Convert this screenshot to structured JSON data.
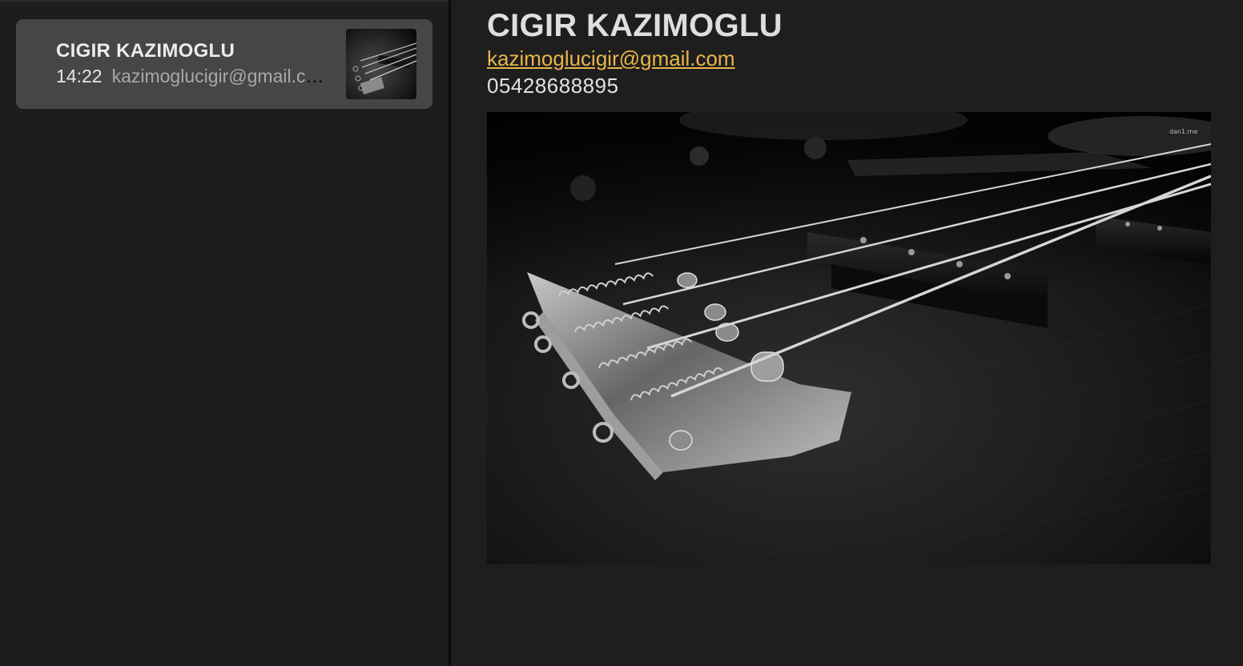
{
  "sidebar": {
    "notes": [
      {
        "title": "CIGIR KAZIMOGLU",
        "time": "14:22",
        "preview": "kazimoglucigir@gmail.com",
        "thumbnail_icon": "bass-guitar-photo-thumbnail"
      }
    ]
  },
  "note": {
    "title": "CIGIR KAZIMOGLU",
    "email": "kazimoglucigir@gmail.com",
    "phone": "05428688895",
    "image_icon": "bass-guitar-bridge-photo"
  },
  "colors": {
    "link": "#e9b54a",
    "selected_item_bg": "#464648",
    "sidebar_bg": "#1c1d1f",
    "editor_bg": "#1e1e1e"
  }
}
